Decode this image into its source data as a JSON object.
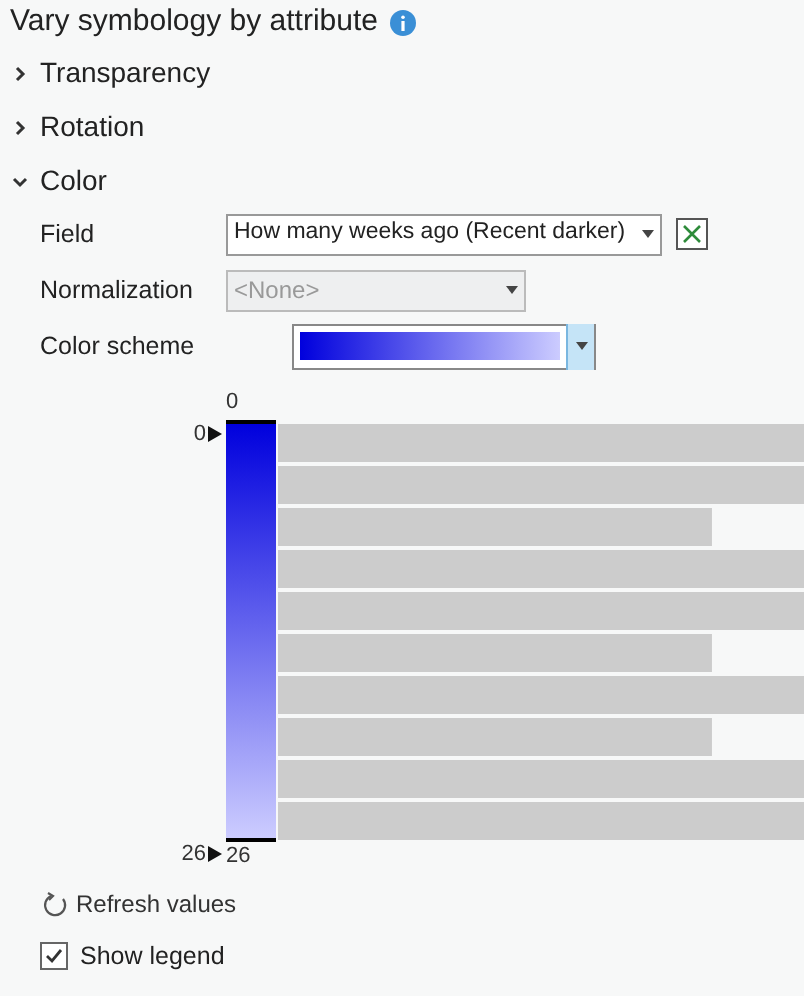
{
  "title": "Vary symbology by attribute",
  "sections": [
    {
      "label": "Transparency",
      "expanded": false
    },
    {
      "label": "Rotation",
      "expanded": false
    },
    {
      "label": "Color",
      "expanded": true
    }
  ],
  "color": {
    "field": {
      "label": "Field",
      "value": "How many weeks ago (Recent darker)"
    },
    "normalization": {
      "label": "Normalization",
      "value": "<None>",
      "disabled": true
    },
    "color_scheme": {
      "label": "Color scheme"
    },
    "histogram": {
      "top_label": "0",
      "bottom_label": "26",
      "top_handle": "0",
      "bottom_handle": "26"
    }
  },
  "refresh": "Refresh values",
  "show_legend": {
    "label": "Show legend",
    "checked": true
  }
}
